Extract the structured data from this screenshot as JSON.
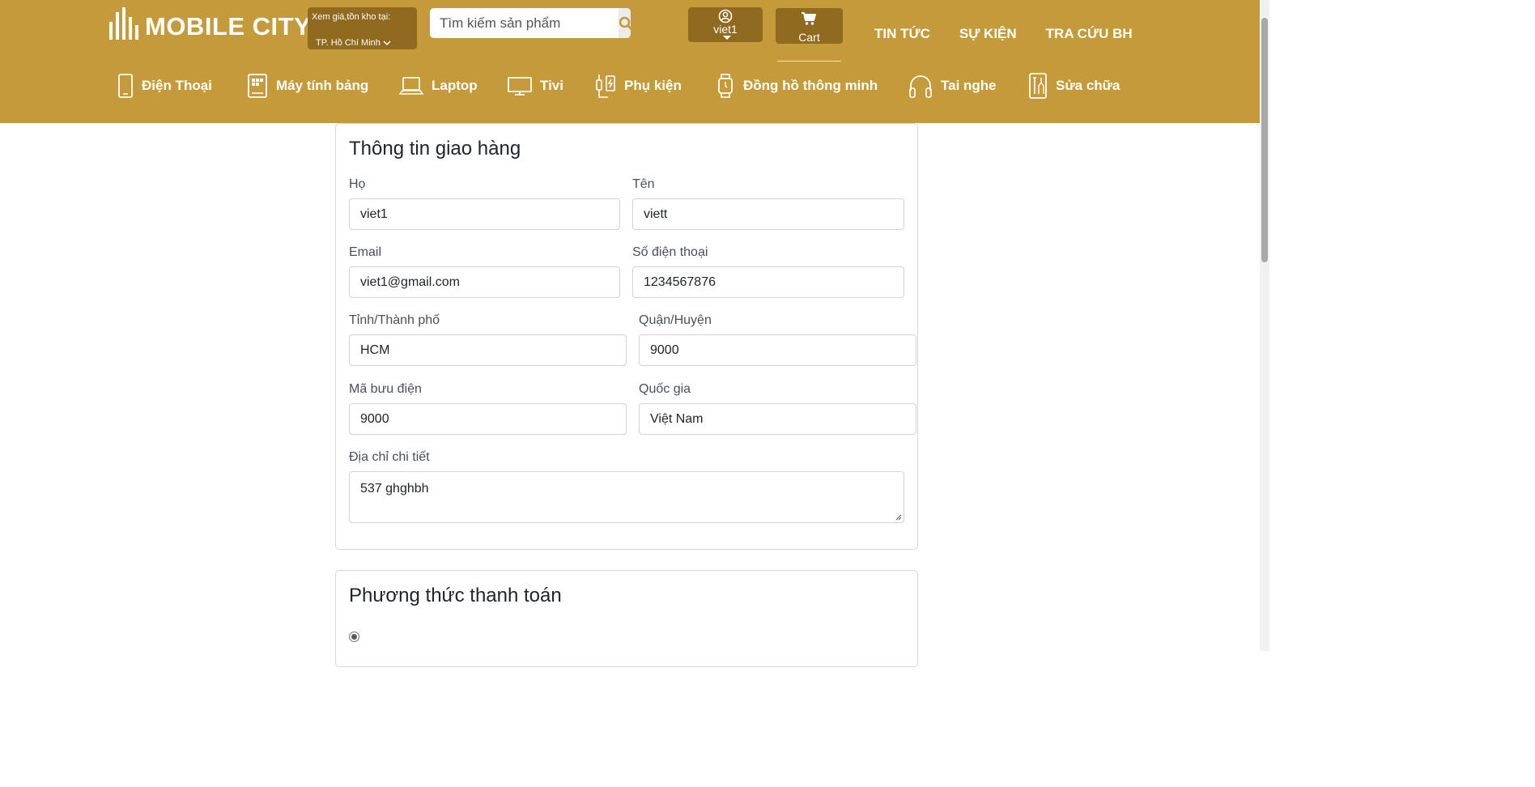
{
  "header": {
    "logo_text": "MOBILE CITY",
    "store": {
      "label": "Xem giá,tồn kho tại:",
      "location": "TP. Hồ Chí Minh"
    },
    "search": {
      "placeholder": "Tìm kiếm sản phẩm",
      "icon": "search-icon"
    },
    "user": {
      "name": "viet1",
      "icon": "user-circle-icon"
    },
    "cart": {
      "label": "Cart",
      "icon": "cart-icon"
    },
    "links": [
      "TIN TỨC",
      "SỰ KIỆN",
      "TRA CỨU BH"
    ],
    "categories": [
      {
        "label": "Điện Thoại",
        "icon": "phone-icon"
      },
      {
        "label": "Máy tính bảng",
        "icon": "tablet-icon"
      },
      {
        "label": "Laptop",
        "icon": "laptop-icon"
      },
      {
        "label": "Tivi",
        "icon": "tv-icon"
      },
      {
        "label": "Phụ kiện",
        "icon": "accessory-icon"
      },
      {
        "label": "Đồng hồ thông minh",
        "icon": "watch-icon"
      },
      {
        "label": "Tai nghe",
        "icon": "headphones-icon"
      },
      {
        "label": "Sửa chữa",
        "icon": "repair-icon"
      }
    ]
  },
  "shipping": {
    "title": "Thông tin giao hàng",
    "last_name": {
      "label": "Họ",
      "value": "viet1"
    },
    "first_name": {
      "label": "Tên",
      "value": "viett"
    },
    "email": {
      "label": "Email",
      "value": "viet1@gmail.com"
    },
    "phone": {
      "label": "Số điện thoại",
      "value": "1234567876"
    },
    "city": {
      "label": "Tỉnh/Thành phố",
      "value": "HCM"
    },
    "district": {
      "label": "Quận/Huyện",
      "value": "9000"
    },
    "postal_code": {
      "label": "Mã bưu điện",
      "value": "9000"
    },
    "country": {
      "label": "Quốc gia",
      "value": "Việt Nam"
    },
    "address": {
      "label": "Địa chỉ chi tiết",
      "value": "537 ghghbh"
    }
  },
  "payment": {
    "title": "Phương thức thanh toán",
    "first_option_selected": true
  },
  "colors": {
    "header_bg": "#c59a3a",
    "header_box_bg": "#8f6a1f",
    "border": "#ced4da"
  }
}
